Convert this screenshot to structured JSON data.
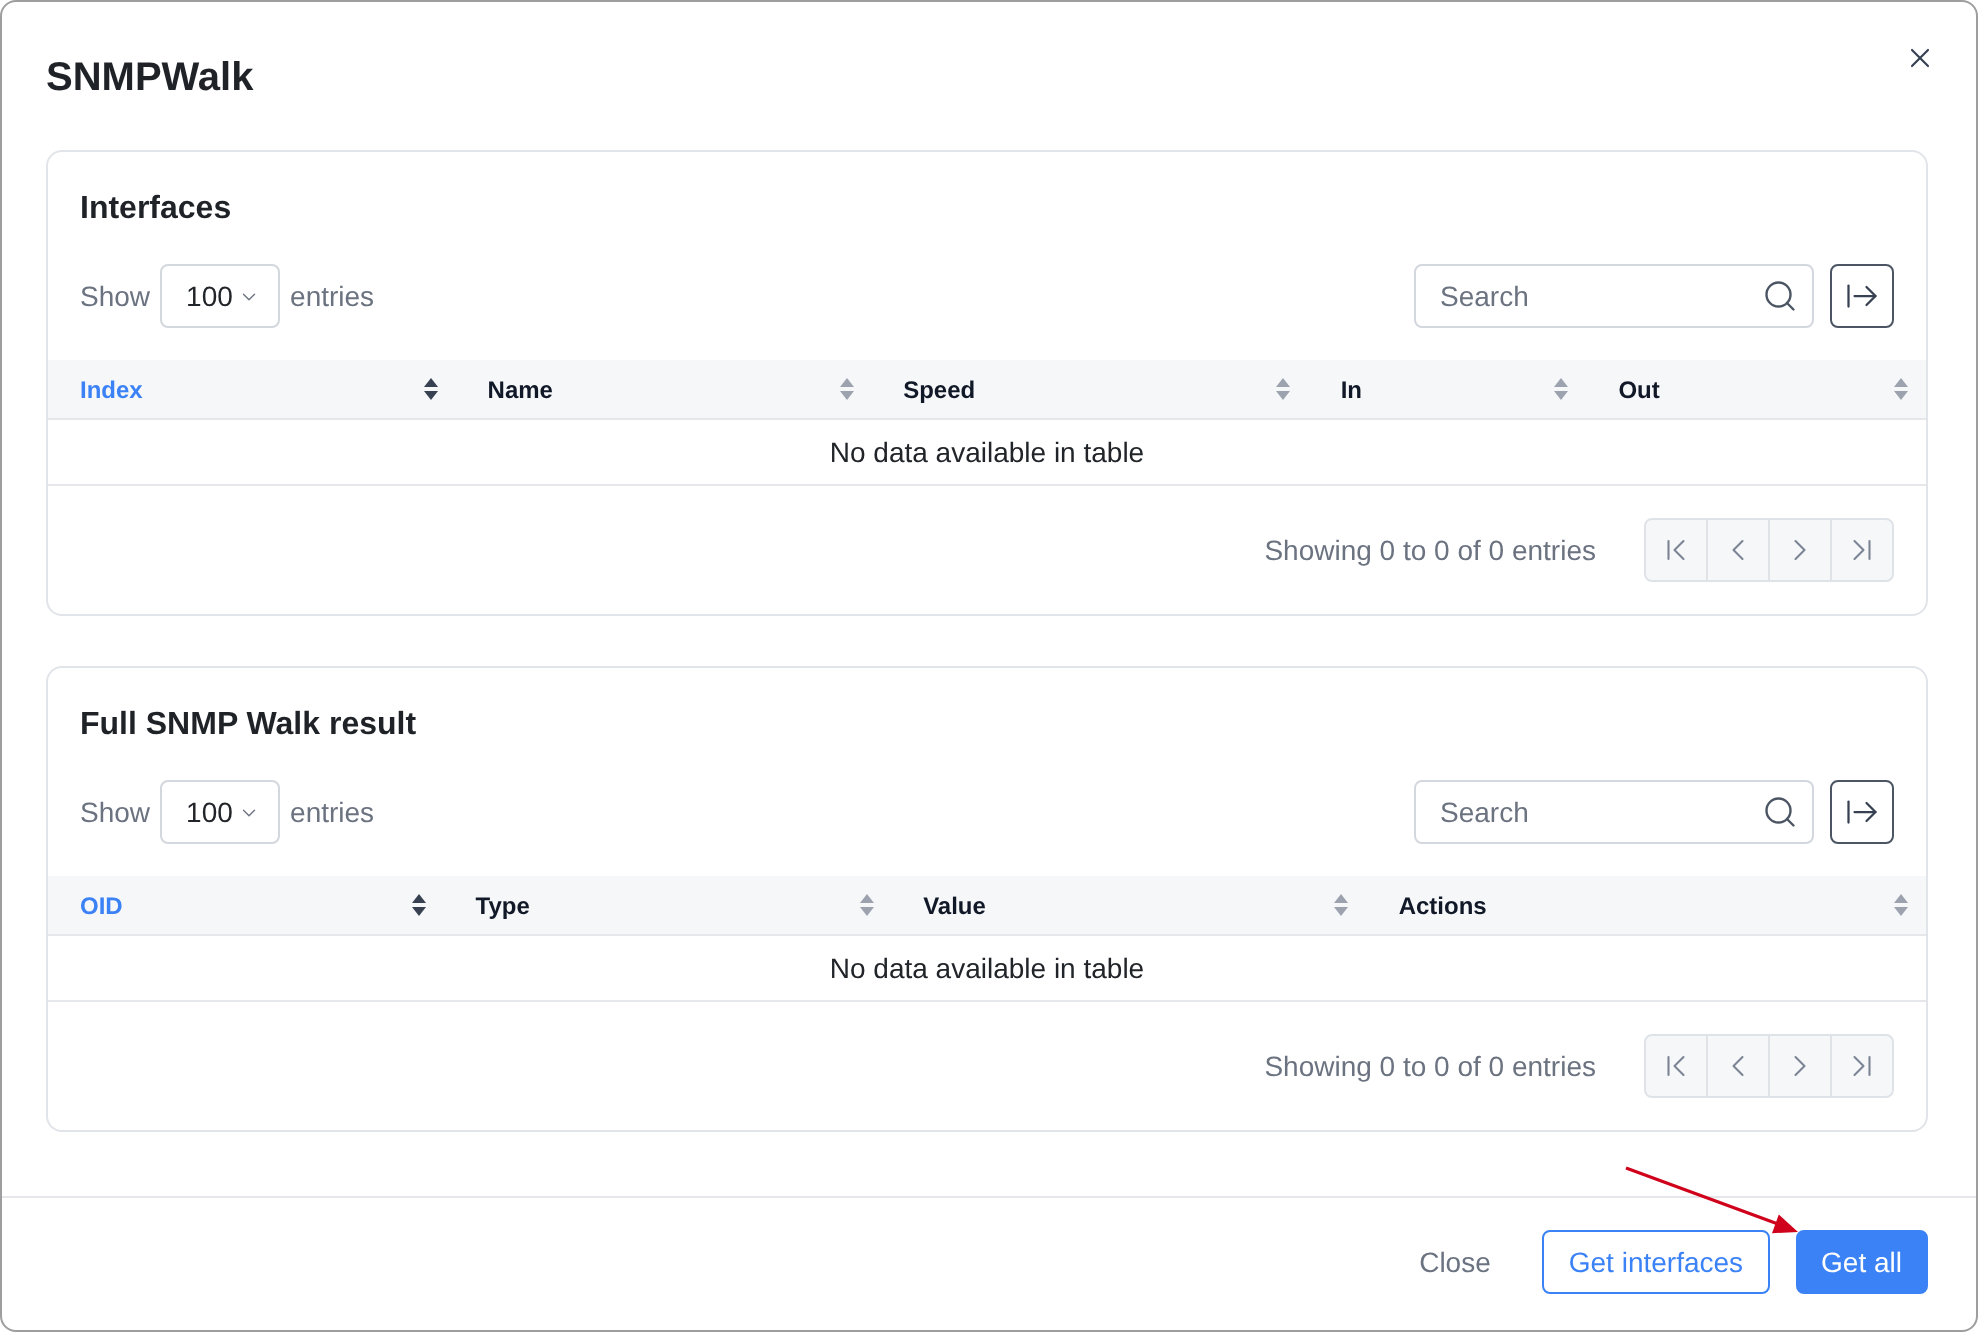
{
  "dialog": {
    "title": "SNMPWalk"
  },
  "tables": [
    {
      "title": "Interfaces",
      "length_menu": {
        "label": "Show",
        "value": "100",
        "suffix": "entries"
      },
      "search": {
        "placeholder": "Search"
      },
      "columns": [
        {
          "label": "Index",
          "sorted": true
        },
        {
          "label": "Name",
          "sorted": false
        },
        {
          "label": "Speed",
          "sorted": false
        },
        {
          "label": "In",
          "sorted": false
        },
        {
          "label": "Out",
          "sorted": false
        }
      ],
      "empty_message": "No data available in table",
      "info": "Showing 0 to 0 of 0 entries",
      "pagination": [
        {
          "kind": "first",
          "disabled": true
        },
        {
          "kind": "previous",
          "disabled": true
        },
        {
          "kind": "next",
          "disabled": true
        },
        {
          "kind": "last",
          "disabled": true
        }
      ]
    },
    {
      "title": "Full SNMP Walk result",
      "length_menu": {
        "label": "Show",
        "value": "100",
        "suffix": "entries"
      },
      "search": {
        "placeholder": "Search"
      },
      "columns": [
        {
          "label": "OID",
          "sorted": true
        },
        {
          "label": "Type",
          "sorted": false
        },
        {
          "label": "Value",
          "sorted": false
        },
        {
          "label": "Actions",
          "sorted": false
        }
      ],
      "empty_message": "No data available in table",
      "info": "Showing 0 to 0 of 0 entries",
      "pagination": [
        {
          "kind": "first",
          "disabled": true
        },
        {
          "kind": "previous",
          "disabled": true
        },
        {
          "kind": "next",
          "disabled": true
        },
        {
          "kind": "last",
          "disabled": true
        }
      ]
    }
  ],
  "footer": {
    "buttons": [
      {
        "label": "Close",
        "kind": "plain"
      },
      {
        "label": "Get interfaces",
        "kind": "outline"
      },
      {
        "label": "Get all",
        "kind": "primary"
      }
    ]
  }
}
